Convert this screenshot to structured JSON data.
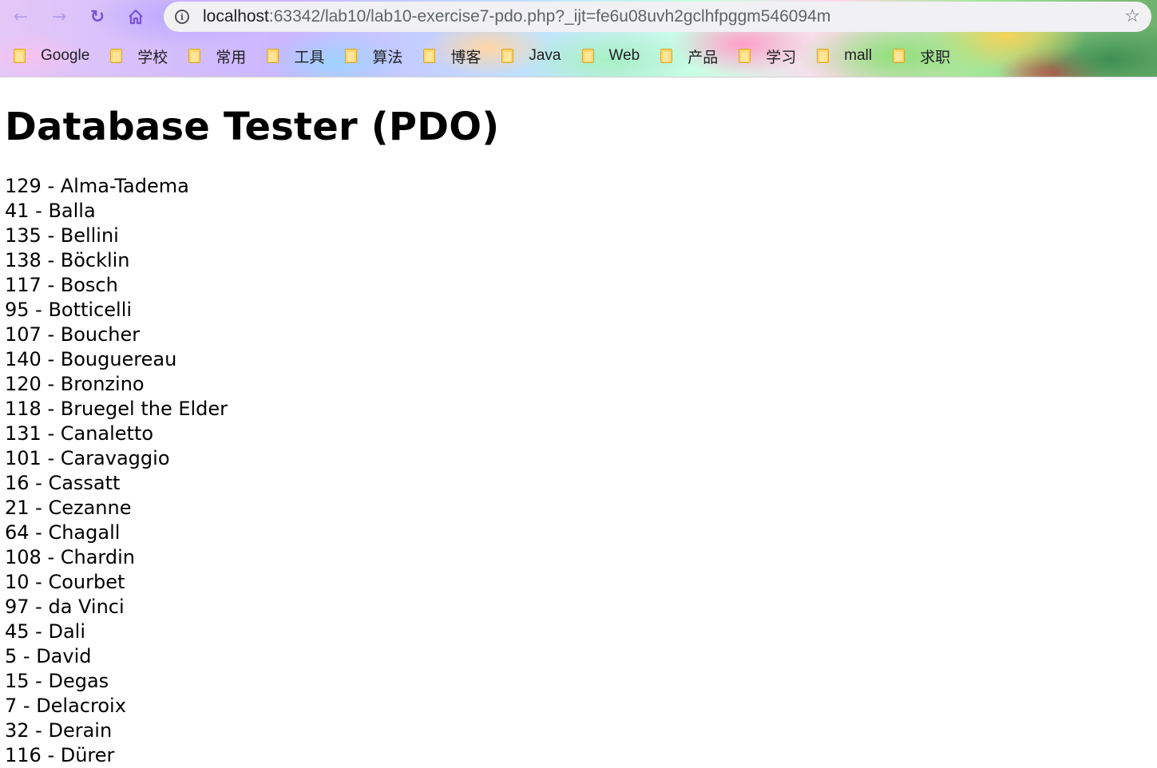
{
  "browser": {
    "url_host": "localhost",
    "url_path": ":63342/lab10/lab10-exercise7-pdo.php?_ijt=fe6u08uvh2gclhfpggm546094m",
    "icons": {
      "back": "arrow-left",
      "forward": "arrow-right",
      "reload": "reload",
      "home": "home",
      "info": "info",
      "star": "star"
    },
    "bookmarks": [
      {
        "label": "Google"
      },
      {
        "label": "学校"
      },
      {
        "label": "常用"
      },
      {
        "label": "工具"
      },
      {
        "label": "算法"
      },
      {
        "label": "博客"
      },
      {
        "label": "Java"
      },
      {
        "label": "Web"
      },
      {
        "label": "产品"
      },
      {
        "label": "学习"
      },
      {
        "label": "mall"
      },
      {
        "label": "求职"
      }
    ]
  },
  "page": {
    "title": "Database Tester (PDO)",
    "rows": [
      "129 - Alma-Tadema",
      "41 - Balla",
      "135 - Bellini",
      "138 - Böcklin",
      "117 - Bosch",
      "95 - Botticelli",
      "107 - Boucher",
      "140 - Bouguereau",
      "120 - Bronzino",
      "118 - Bruegel the Elder",
      "131 - Canaletto",
      "101 - Caravaggio",
      "16 - Cassatt",
      "21 - Cezanne",
      "64 - Chagall",
      "108 - Chardin",
      "10 - Courbet",
      "97 - da Vinci",
      "45 - Dali",
      "5 - David",
      "15 - Degas",
      "7 - Delacroix",
      "32 - Derain",
      "116 - Dürer"
    ]
  }
}
